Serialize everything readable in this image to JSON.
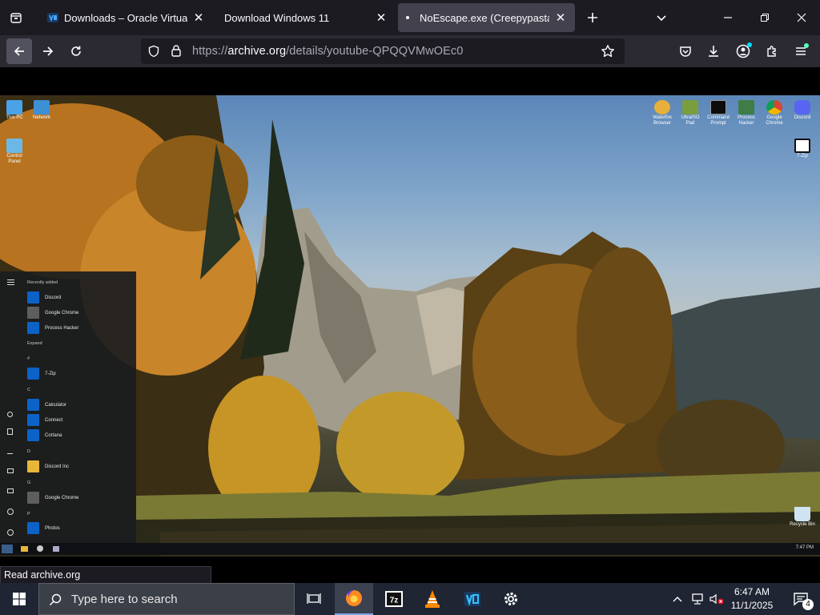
{
  "browser": {
    "tabs": [
      {
        "label": "Downloads – Oracle VirtualBox",
        "close": "✕",
        "active": false
      },
      {
        "label": "Download Windows 11",
        "close": "✕",
        "active": false
      },
      {
        "label": "NoEscape.exe (Creepypasta) : E",
        "close": "✕",
        "active": true
      }
    ],
    "url_prefix": "https://",
    "url_domain": "archive.org",
    "url_path": "/details/youtube-QPQQVMwOEc0",
    "status_text": "Read archive.org"
  },
  "vm": {
    "desktop_left": [
      {
        "label": "This PC"
      },
      {
        "label": "Network"
      },
      {
        "label": "Control Panel"
      }
    ],
    "desktop_right": [
      {
        "label": "Waterfox Browser"
      },
      {
        "label": "UltraISO Pad"
      },
      {
        "label": "Command Prompt"
      },
      {
        "label": "Process Hacker"
      },
      {
        "label": "Google Chrome"
      },
      {
        "label": "Discord"
      },
      {
        "label": "7-Zip"
      }
    ],
    "recycle_bin": "Recycle Bin",
    "start_menu": {
      "recently_added": "Recently added",
      "recent": [
        "Discord",
        "Google Chrome",
        "Process Hacker"
      ],
      "expand": "Expand",
      "sections": [
        {
          "letter": "#",
          "items": [
            "7-Zip"
          ]
        },
        {
          "letter": "C",
          "items": [
            "Calculator",
            "Connect",
            "Cortana"
          ]
        },
        {
          "letter": "D",
          "items": [
            "Discord Inc"
          ]
        },
        {
          "letter": "G",
          "items": [
            "Google Chrome"
          ]
        },
        {
          "letter": "P",
          "items": [
            "Photos"
          ]
        }
      ]
    },
    "vm_clock": "7:47 PM"
  },
  "taskbar": {
    "search_placeholder": "Type here to search",
    "time": "6:47 AM",
    "date": "11/1/2025",
    "notifications": "4"
  }
}
